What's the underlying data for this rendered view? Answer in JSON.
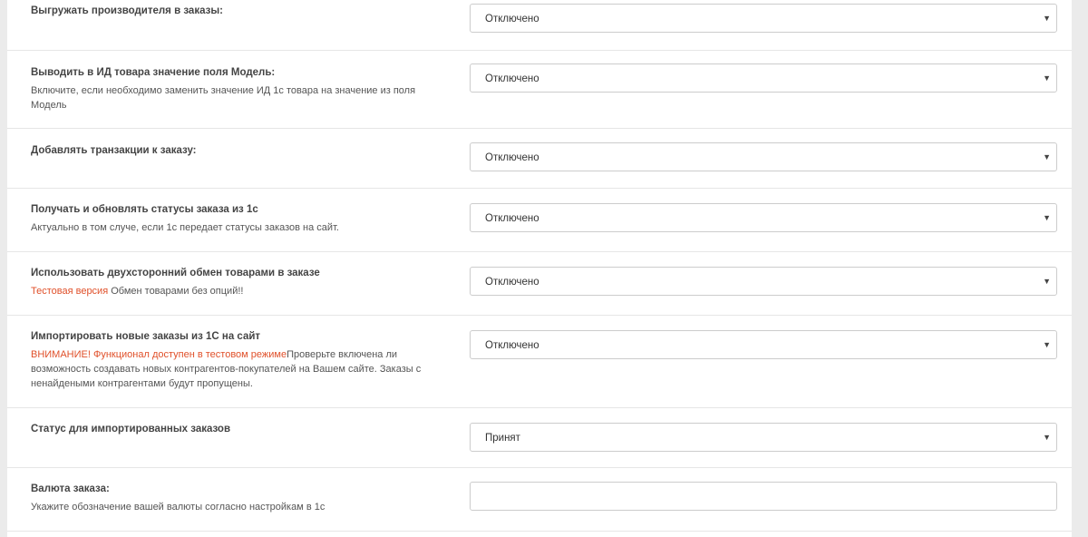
{
  "settings": [
    {
      "label": "Выгружать производителя в заказы:",
      "value": "Отключено"
    },
    {
      "label": "Выводить в ИД товара значение поля Модель:",
      "help": "Включите, если необходимо заменить значение ИД 1с товара на значение из поля Модель",
      "value": "Отключено"
    },
    {
      "label": "Добавлять транзакции к заказу:",
      "value": "Отключено"
    },
    {
      "label": "Получать и обновлять статусы заказа из 1с",
      "help": "Актуально в том случе, если 1с передает статусы заказов на сайт.",
      "value": "Отключено"
    },
    {
      "label": "Использовать двухсторонний обмен товарами в заказе",
      "help_warn": "Тестовая версия",
      "help": " Обмен товарами без опций!!",
      "value": "Отключено"
    },
    {
      "label": "Импортировать новые заказы из 1С на сайт",
      "help_warn": "ВНИМАНИЕ! Функционал доступен в тестовом режиме",
      "help": "Проверьте включена ли возможность создавать новых контрагентов-покупателей на Вашем сайте. Заказы с ненайдеными контрагентами будут пропущены.",
      "value": "Отключено"
    },
    {
      "label": "Статус для импортированных заказов",
      "value": "Принят"
    },
    {
      "label": "Валюта заказа:",
      "help": "Укажите обозначение вашей валюты согласно настройкам в 1с",
      "value": ""
    }
  ]
}
